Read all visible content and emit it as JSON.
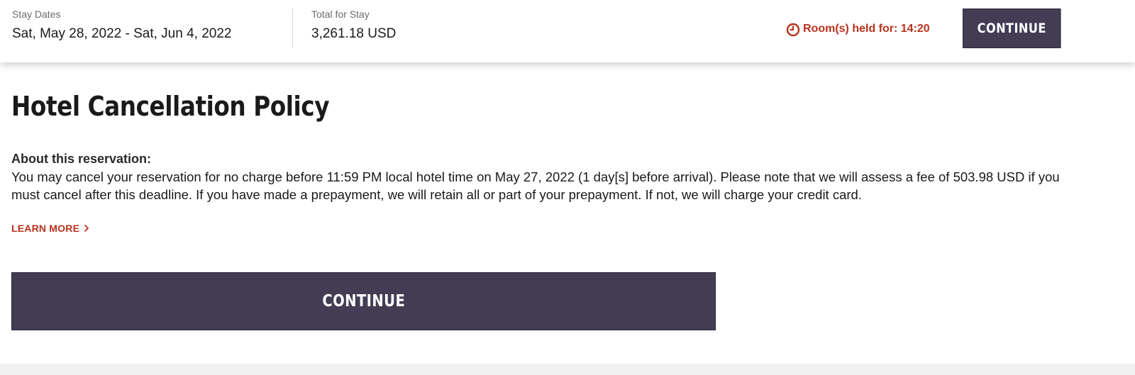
{
  "summary": {
    "stay_dates_label": "Stay Dates",
    "stay_dates_value": "Sat, May 28, 2022 - Sat, Jun 4, 2022",
    "total_label": "Total for Stay",
    "total_value": "3,261.18 USD"
  },
  "timer": {
    "icon": "clock-icon",
    "text": "Room(s) held for: 14:20",
    "color": "#b8321d"
  },
  "header_button": {
    "label": "CONTINUE"
  },
  "policy": {
    "title": "Hotel Cancellation Policy",
    "about_heading": "About this reservation:",
    "about_body": "You may cancel your reservation for no charge before 11:59 PM local hotel time on May 27, 2022 (1 day[s] before arrival). Please note that we will assess a fee of 503.98 USD if you must cancel after this deadline. If you have made a prepayment, we will retain all or part of your prepayment. If not, we will charge your credit card.",
    "learn_more": "LEARN MORE",
    "learn_more_icon": "chevron-right-icon"
  },
  "main_button": {
    "label": "CONTINUE"
  },
  "colors": {
    "button_bg": "#433d54",
    "accent": "#b8321d"
  }
}
